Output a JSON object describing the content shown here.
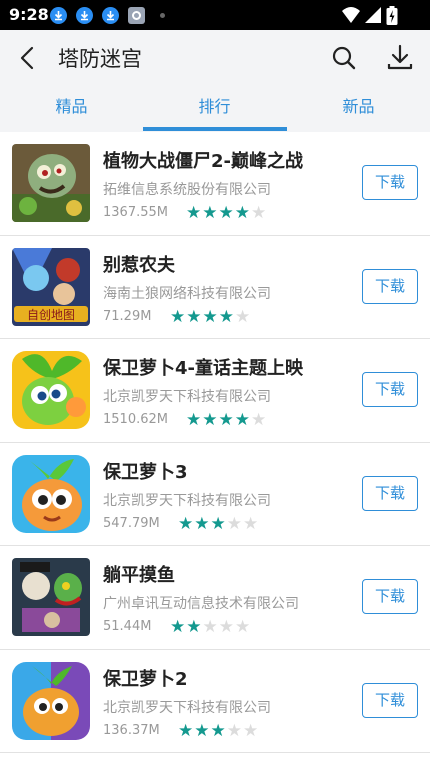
{
  "status_bar": {
    "time": "9:28"
  },
  "header": {
    "title": "塔防迷宫"
  },
  "tabs": [
    {
      "label": "精品",
      "active": false
    },
    {
      "label": "排行",
      "active": true
    },
    {
      "label": "新品",
      "active": false
    }
  ],
  "apps": [
    {
      "name": "植物大战僵尸2-巅峰之战",
      "developer": "拓维信息系统股份有限公司",
      "size": "1367.55M",
      "rating": 4,
      "action": "下载"
    },
    {
      "name": "别惹农夫",
      "developer": "海南土狼网络科技有限公司",
      "size": "71.29M",
      "rating": 4,
      "action": "下载"
    },
    {
      "name": "保卫萝卜4-童话主题上映",
      "developer": "北京凯罗天下科技有限公司",
      "size": "1510.62M",
      "rating": 4,
      "action": "下载"
    },
    {
      "name": "保卫萝卜3",
      "developer": "北京凯罗天下科技有限公司",
      "size": "547.79M",
      "rating": 3,
      "action": "下载"
    },
    {
      "name": "躺平摸鱼",
      "developer": "广州卓讯互动信息技术有限公司",
      "size": "51.44M",
      "rating": 2,
      "action": "下载"
    },
    {
      "name": "保卫萝卜2",
      "developer": "北京凯罗天下科技有限公司",
      "size": "136.37M",
      "rating": 3,
      "action": "下载"
    }
  ],
  "colors": {
    "accent": "#2f8ed8",
    "star_on": "#14998f",
    "star_off": "#dcdcdc"
  }
}
